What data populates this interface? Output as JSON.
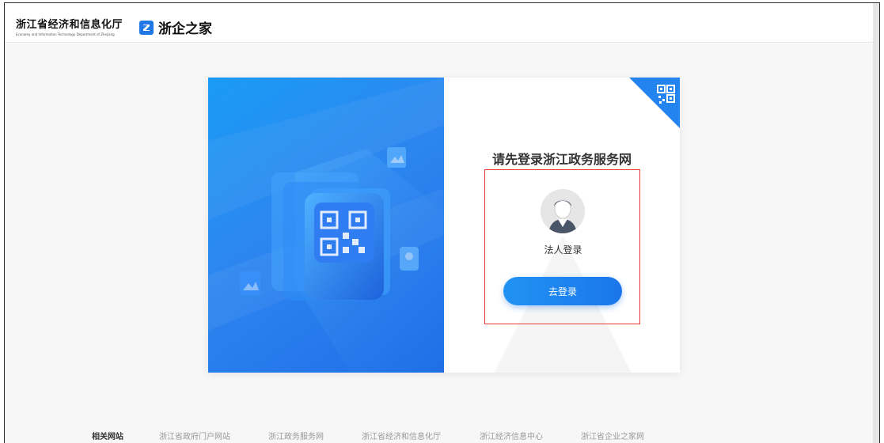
{
  "header": {
    "org_name_cn": "浙江省经济和信息化厅",
    "org_name_en": "Economy and Information Technology Department of Zhejiang",
    "brand_name": "浙企之家"
  },
  "login": {
    "title": "请先登录浙江政务服务网",
    "role_label": "法人登录",
    "button_label": "去登录",
    "corner_icon": "qr-code-icon",
    "avatar_icon": "user-avatar-icon"
  },
  "footer": {
    "title": "相关网站",
    "links": [
      "浙江省政府门户网站",
      "浙江政务服务网",
      "浙江省经济和信息化厅",
      "浙江经济信息中心",
      "浙江省企业之家网"
    ]
  },
  "colors": {
    "accent": "#1f78e6",
    "highlight_border": "#e53935",
    "panel_gradient_start": "#1a9bf5",
    "panel_gradient_end": "#1f6ee6"
  }
}
